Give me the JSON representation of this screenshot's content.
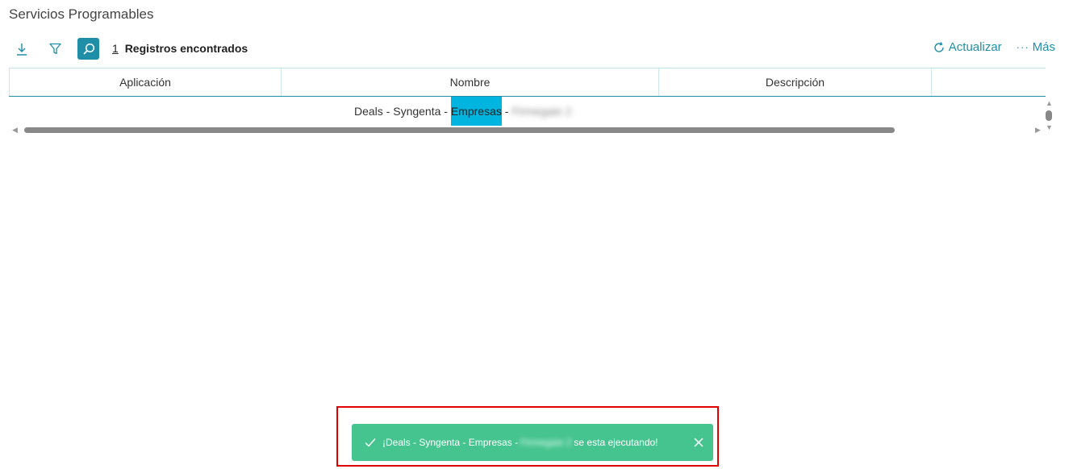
{
  "page": {
    "title": "Servicios Programables"
  },
  "toolbar": {
    "records_count": "1",
    "records_label": "Registros encontrados",
    "refresh_label": "Actualizar",
    "more_label": "Más"
  },
  "grid": {
    "columns": [
      "Aplicación",
      "Nombre",
      "Descripción",
      ""
    ],
    "rows": [
      {
        "name_prefix": "Deals - Syngenta -",
        "name_highlight": "Empresas",
        "name_sep": "-",
        "name_blurred": "Firmegaie 2"
      }
    ]
  },
  "toast": {
    "message_prefix": "¡Deals - Syngenta - Empresas -",
    "message_blurred": "Firmegaie 2",
    "message_suffix": "se esta ejecutando!"
  },
  "colors": {
    "accent": "#1f8fa8",
    "toast_bg": "#46c48f",
    "highlight": "#00b4e0",
    "outline": "#e00000"
  }
}
